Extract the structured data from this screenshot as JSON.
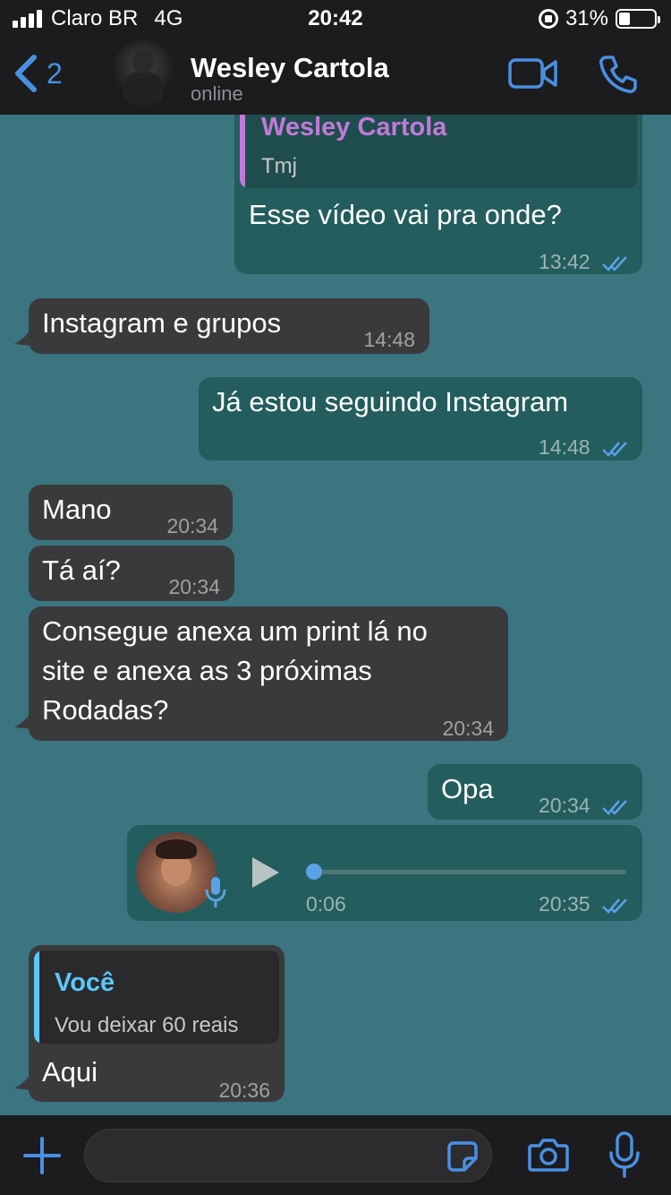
{
  "status_bar": {
    "carrier": "Claro BR",
    "network": "4G",
    "time": "20:42",
    "battery_text": "31%",
    "battery_level": 0.31
  },
  "header": {
    "back_count": "2",
    "contact_name": "Wesley Cartola",
    "contact_status": "online",
    "accent_color": "#4a90e2"
  },
  "messages": {
    "m1": {
      "reply_author": "Wesley Cartola",
      "reply_text": "Tmj",
      "text": "Esse vídeo vai pra onde?",
      "time": "13:42"
    },
    "m2": {
      "text": "Instagram e grupos",
      "time": "14:48"
    },
    "m3": {
      "text": "Já estou seguindo Instagram",
      "time": "14:48"
    },
    "m4": {
      "text": "Mano",
      "time": "20:34"
    },
    "m5": {
      "text": "Tá aí?",
      "time": "20:34"
    },
    "m6": {
      "line1": "Consegue anexa um print lá no",
      "line2": "site e anexa as 3 próximas",
      "line3": "Rodadas?",
      "time": "20:34"
    },
    "m7": {
      "text": "Opa",
      "time": "20:34"
    },
    "m8": {
      "duration": "0:06",
      "time": "20:35",
      "progress": 0.0
    },
    "m9": {
      "reply_author": "Você",
      "reply_text": "Vou deixar 60 reais",
      "text": "Aqui",
      "time": "20:36"
    }
  },
  "icons": {
    "back": "chevron-left-icon",
    "video": "video-camera-icon",
    "call": "phone-icon",
    "read": "double-check-icon",
    "plus": "plus-icon",
    "sticker": "sticker-icon",
    "camera": "camera-icon",
    "mic": "microphone-icon",
    "play": "play-icon"
  },
  "colors": {
    "chat_background": "#3a7580",
    "incoming_bubble": "#3a3a3c",
    "outgoing_bubble": "#245d5e",
    "read_ticks": "#5aa2e6",
    "reply_bar_contact": "#c17ad6",
    "reply_bar_self": "#5ac8fa"
  }
}
